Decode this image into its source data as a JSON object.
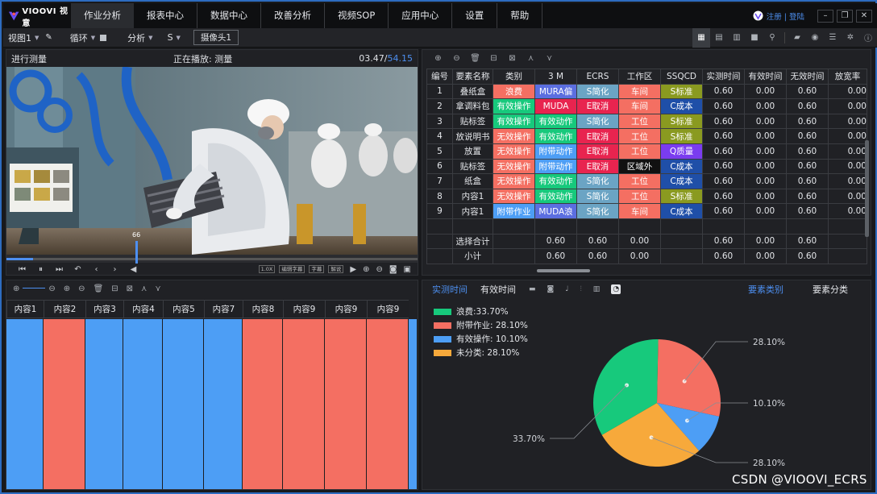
{
  "app": {
    "logo_text": "VIOOVI 视意"
  },
  "nav": {
    "items": [
      {
        "label": "作业分析",
        "active": true
      },
      {
        "label": "报表中心"
      },
      {
        "label": "数据中心"
      },
      {
        "label": "改善分析"
      },
      {
        "label": "视频SOP"
      },
      {
        "label": "应用中心"
      },
      {
        "label": "设置"
      },
      {
        "label": "帮助"
      }
    ],
    "user_links": "注册 | 登陆"
  },
  "toolbar": {
    "view": "视图1",
    "loop": "循环",
    "analysis": "分析",
    "mode": "S",
    "camera": "摄像头1"
  },
  "video": {
    "title": "进行测量",
    "status": "正在播放: 测量",
    "time_current": "03.47",
    "time_total": "54.15",
    "volume": "66",
    "progress": 0.064,
    "chips": [
      "1.0X",
      "编辑字幕",
      "字幕",
      "解说"
    ]
  },
  "table": {
    "headers": [
      "编号",
      "要素名称",
      "类别",
      "3 M",
      "ECRS",
      "工作区",
      "SSQCD",
      "实测时间",
      "有效时间",
      "无效时间",
      "放宽率"
    ],
    "rows": [
      {
        "no": "1",
        "name": "叠纸盒",
        "cat": "浪费",
        "m": "MURA偏",
        "ecrs": "S简化",
        "area": "车间",
        "ssqcd": "S标准",
        "t1": "0.60",
        "t2": "0.00",
        "t3": "0.60",
        "t4": "0.00"
      },
      {
        "no": "2",
        "name": "拿调料包",
        "cat": "有效操作",
        "m": "MUDA",
        "ecrs": "E取消",
        "area": "车间",
        "ssqcd": "C成本",
        "t1": "0.60",
        "t2": "0.00",
        "t3": "0.60",
        "t4": "0.00"
      },
      {
        "no": "3",
        "name": "贴标签",
        "cat": "有效操作",
        "m": "有效动作",
        "ecrs": "S简化",
        "area": "工位",
        "ssqcd": "S标准",
        "t1": "0.60",
        "t2": "0.00",
        "t3": "0.60",
        "t4": "0.00"
      },
      {
        "no": "4",
        "name": "放说明书",
        "cat": "无效操作",
        "m": "有效动作",
        "ecrs": "E取消",
        "area": "工位",
        "ssqcd": "S标准",
        "t1": "0.60",
        "t2": "0.00",
        "t3": "0.60",
        "t4": "0.00"
      },
      {
        "no": "5",
        "name": "放置",
        "cat": "无效操作",
        "m": "附带动作",
        "ecrs": "E取消",
        "area": "工位",
        "ssqcd": "Q质量",
        "t1": "0.60",
        "t2": "0.00",
        "t3": "0.60",
        "t4": "0.00"
      },
      {
        "no": "6",
        "name": "贴标签",
        "cat": "无效操作",
        "m": "附带动作",
        "ecrs": "E取消",
        "area": "区域外",
        "ssqcd": "C成本",
        "t1": "0.60",
        "t2": "0.00",
        "t3": "0.60",
        "t4": "0.00"
      },
      {
        "no": "7",
        "name": "纸盒",
        "cat": "无效操作",
        "m": "有效动作",
        "ecrs": "S简化",
        "area": "工位",
        "ssqcd": "C成本",
        "t1": "0.60",
        "t2": "0.00",
        "t3": "0.60",
        "t4": "0.00"
      },
      {
        "no": "8",
        "name": "内容1",
        "cat": "无效操作",
        "m": "有效动作",
        "ecrs": "S简化",
        "area": "工位",
        "ssqcd": "S标准",
        "t1": "0.60",
        "t2": "0.00",
        "t3": "0.60",
        "t4": "0.00"
      },
      {
        "no": "9",
        "name": "内容1",
        "cat": "附带作业",
        "m": "MUDA浪",
        "ecrs": "S简化",
        "area": "车间",
        "ssqcd": "C成本",
        "t1": "0.60",
        "t2": "0.00",
        "t3": "0.60",
        "t4": "0.00"
      }
    ],
    "summary": [
      {
        "label": "选择合计",
        "m": "0.60",
        "ecrs": "0.60",
        "area": "0.00",
        "t1": "0.60",
        "t2": "0.00",
        "t3": "0.60"
      },
      {
        "label": "小计",
        "m": "0.60",
        "ecrs": "0.60",
        "area": "0.00",
        "t1": "0.60",
        "t2": "0.00",
        "t3": "0.60"
      }
    ],
    "colors": {
      "浪费": "#f46f62",
      "有效操作": "#17c97c",
      "无效操作": "#f46f62",
      "附带作业": "#4d9ef5",
      "MURA偏": "#5b6ee0",
      "MUDA": "#e8244f",
      "有效动作": "#17c97c",
      "附带动作": "#4d9ef5",
      "MUDA浪": "#5b6ee0",
      "S简化": "#6ba4c4",
      "E取消": "#e8244f",
      "车间": "#f46f62",
      "工位": "#f46f62",
      "区域外": "#111111",
      "S标准": "#8a9a20",
      "C成本": "#1f4fa8",
      "Q质量": "#7a3cf0"
    }
  },
  "timeline": {
    "cells": [
      {
        "label": "内容1",
        "color": "#4d9ef5"
      },
      {
        "label": "内容2",
        "color": "#f46f62"
      },
      {
        "label": "内容3",
        "color": "#4d9ef5"
      },
      {
        "label": "内容4",
        "color": "#4d9ef5"
      },
      {
        "label": "内容5",
        "color": "#4d9ef5"
      },
      {
        "label": "内容7",
        "color": "#4d9ef5"
      },
      {
        "label": "内容8",
        "color": "#f46f62"
      },
      {
        "label": "内容9",
        "color": "#f46f62"
      },
      {
        "label": "内容9",
        "color": "#f46f62"
      },
      {
        "label": "内容9",
        "color": "#f46f62"
      }
    ]
  },
  "chart_panel": {
    "tabs": [
      "实测时间",
      "有效时间"
    ],
    "right_tabs": [
      "要素类别",
      "要素分类"
    ]
  },
  "chart_data": {
    "type": "pie",
    "labels": [
      "浪费",
      "附带作业",
      "有效操作",
      "未分类"
    ],
    "values": [
      33.7,
      28.1,
      10.1,
      28.1
    ],
    "colors": [
      "#17c97c",
      "#f46f62",
      "#4d9ef5",
      "#f7a93b"
    ],
    "legend": [
      "浪费:33.70%",
      "附带作业: 28.10%",
      "有效操作: 10.10%",
      "未分类: 28.10%"
    ],
    "data_labels": [
      "33.70%",
      "28.10%",
      "10.10%",
      "28.10%"
    ],
    "legend_position": "top-left"
  },
  "watermark": "CSDN @VIOOVI_ECRS"
}
